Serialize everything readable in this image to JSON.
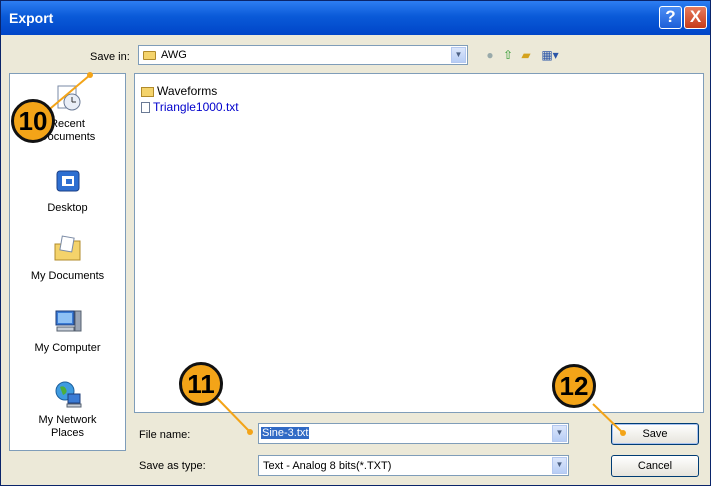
{
  "window": {
    "title": "Export"
  },
  "title_buttons": {
    "help": "?",
    "close": "X"
  },
  "save_in": {
    "label": "Save in:",
    "value": "AWG"
  },
  "toolbar": {
    "icons": [
      "back-icon",
      "up-folder-icon",
      "new-folder-icon",
      "views-menu-icon"
    ]
  },
  "places": [
    {
      "label": "My Recent Documents",
      "line1": "Recent",
      "line2": "Documents",
      "icon": "recent-documents-icon"
    },
    {
      "label": "Desktop",
      "line1": "Desktop",
      "line2": "",
      "icon": "desktop-icon"
    },
    {
      "label": "My Documents",
      "line1": "My Documents",
      "line2": "",
      "icon": "my-documents-icon"
    },
    {
      "label": "My Computer",
      "line1": "My Computer",
      "line2": "",
      "icon": "my-computer-icon"
    },
    {
      "label": "My Network Places",
      "line1": "My Network",
      "line2": "Places",
      "icon": "network-places-icon"
    }
  ],
  "files": [
    {
      "name": "Waveforms",
      "type": "folder"
    },
    {
      "name": "Triangle1000.txt",
      "type": "file"
    }
  ],
  "file_name": {
    "label": "File name:",
    "value": "Sine-3.txt"
  },
  "save_as_type": {
    "label": "Save as type:",
    "value": "Text - Analog 8 bits(*.TXT)"
  },
  "buttons": {
    "save": "Save",
    "cancel": "Cancel"
  },
  "callouts": [
    "10",
    "11",
    "12"
  ],
  "colors": {
    "title_bar": "#0a5ad8",
    "callout": "#f3a418",
    "selection": "#316ac5",
    "link_text": "#0000cc"
  }
}
